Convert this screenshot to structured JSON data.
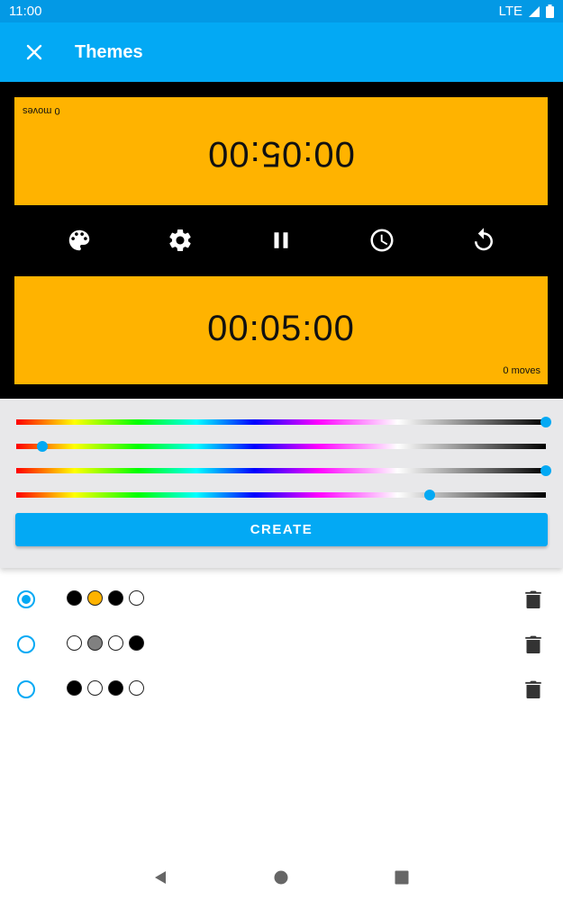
{
  "status_bar": {
    "time": "11:00",
    "network": "LTE"
  },
  "app_bar": {
    "title": "Themes",
    "close_icon": "close-icon"
  },
  "preview": {
    "top_clock": {
      "time": "00:05:00",
      "moves": "0 moves"
    },
    "bottom_clock": {
      "time": "00:05:00",
      "moves": "0 moves"
    },
    "clock_color": "#ffb300",
    "controls": [
      "palette-icon",
      "settings-icon",
      "pause-icon",
      "clock-icon",
      "reset-icon"
    ]
  },
  "sliders": [
    {
      "name": "color-slider-1",
      "value": 1.0
    },
    {
      "name": "color-slider-2",
      "value": 0.05
    },
    {
      "name": "color-slider-3",
      "value": 1.0
    },
    {
      "name": "color-slider-4",
      "value": 0.78
    }
  ],
  "create_button": {
    "label": "CREATE"
  },
  "themes": [
    {
      "selected": true,
      "colors": [
        "#000000",
        "#ffb300",
        "#000000",
        "#ffffff"
      ]
    },
    {
      "selected": false,
      "colors": [
        "#ffffff",
        "#808080",
        "#ffffff",
        "#000000"
      ]
    },
    {
      "selected": false,
      "colors": [
        "#000000",
        "#ffffff",
        "#000000",
        "#ffffff"
      ]
    }
  ],
  "accent_color": "#03a9f4",
  "nav_bar": [
    "back-icon",
    "home-icon",
    "recents-icon"
  ]
}
